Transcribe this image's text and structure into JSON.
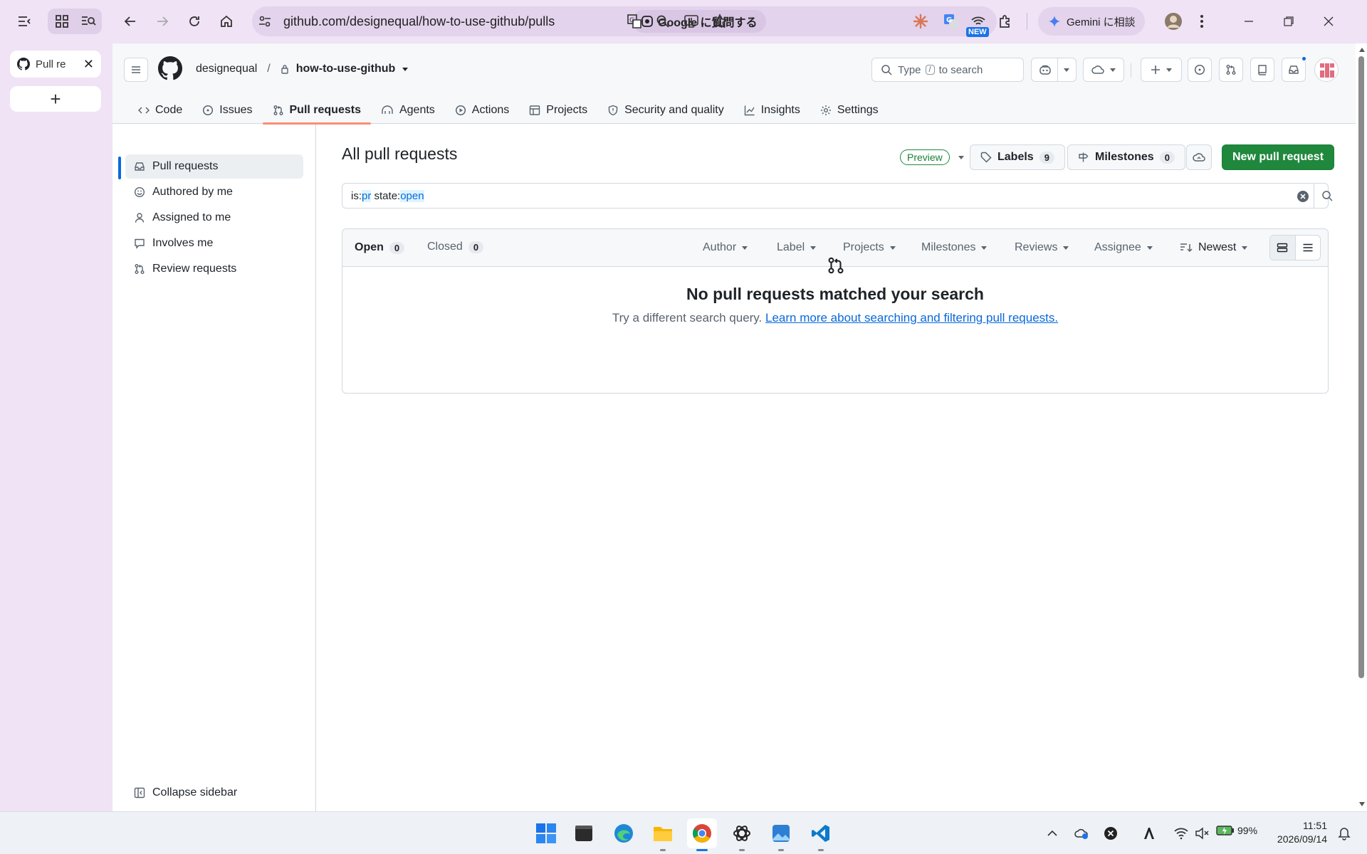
{
  "browser": {
    "tab_title": "Pull re",
    "url": "github.com/designequal/how-to-use-github/pulls",
    "google_ask": "Google に質問する",
    "new_badge": "NEW",
    "gemini": "Gemini に相談"
  },
  "header": {
    "owner": "designequal",
    "separator": "/",
    "repo": "how-to-use-github",
    "search_prefix": "Type",
    "search_key": "/",
    "search_suffix": "to search"
  },
  "repo_nav": [
    {
      "label": "Code",
      "icon": "code-icon"
    },
    {
      "label": "Issues",
      "icon": "issue-icon"
    },
    {
      "label": "Pull requests",
      "icon": "pull-request-icon"
    },
    {
      "label": "Agents",
      "icon": "agents-icon"
    },
    {
      "label": "Actions",
      "icon": "actions-icon"
    },
    {
      "label": "Projects",
      "icon": "projects-icon"
    },
    {
      "label": "Security and quality",
      "icon": "shield-icon"
    },
    {
      "label": "Insights",
      "icon": "graph-icon"
    },
    {
      "label": "Settings",
      "icon": "gear-icon"
    }
  ],
  "sidebar": {
    "items": [
      {
        "label": "Pull requests"
      },
      {
        "label": "Authored by me"
      },
      {
        "label": "Assigned to me"
      },
      {
        "label": "Involves me"
      },
      {
        "label": "Review requests"
      }
    ],
    "collapse": "Collapse sidebar"
  },
  "main": {
    "title": "All pull requests",
    "preview": "Preview",
    "labels": {
      "label": "Labels",
      "count": "9"
    },
    "milestones": {
      "label": "Milestones",
      "count": "0"
    },
    "new_pr": "New pull request",
    "query": {
      "k1": "is:",
      "v1": "pr",
      "k2": " state:",
      "v2": "open"
    },
    "open": {
      "label": "Open",
      "count": "0"
    },
    "closed": {
      "label": "Closed",
      "count": "0"
    },
    "filters": [
      "Author",
      "Label",
      "Projects",
      "Milestones",
      "Reviews",
      "Assignee"
    ],
    "sort": "Newest",
    "empty_title": "No pull requests matched your search",
    "empty_desc": "Try a different search query.",
    "empty_link": "Learn more about searching and filtering pull requests."
  },
  "system": {
    "battery": "99%",
    "time": "11:51",
    "date": "2026/09/14"
  },
  "colors": {
    "accent_green": "#1f883d",
    "link_blue": "#0969da",
    "tab_underline": "#fd8c73",
    "chrome_bg": "#efe3f5"
  }
}
